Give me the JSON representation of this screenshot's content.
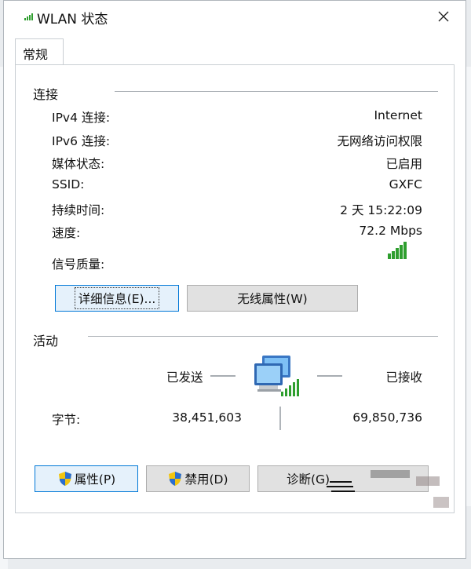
{
  "window": {
    "title": "WLAN 状态"
  },
  "tabs": [
    {
      "label": "常规"
    }
  ],
  "connection": {
    "section_label": "连接",
    "rows": [
      {
        "label": "IPv4 连接:",
        "value": "Internet"
      },
      {
        "label": "IPv6 连接:",
        "value": "无网络访问权限"
      },
      {
        "label": "媒体状态:",
        "value": "已启用"
      },
      {
        "label": "SSID:",
        "value": "GXFC"
      },
      {
        "label": "持续时间:",
        "value": "2 天 15:22:09"
      },
      {
        "label": "速度:",
        "value": "72.2 Mbps"
      }
    ],
    "signal_label": "信号质量:",
    "signal_level": 5,
    "signal_max": 5,
    "details_button": "详细信息(E)...",
    "wireless_props_button": "无线属性(W)"
  },
  "activity": {
    "section_label": "活动",
    "sent_label": "已发送",
    "received_label": "已接收",
    "bytes_label": "字节:",
    "bytes_sent": "38,451,603",
    "bytes_received": "69,850,736"
  },
  "footer": {
    "properties_button": "属性(P)",
    "disable_button": "禁用(D)",
    "diagnose_button": "诊断(G)"
  },
  "colors": {
    "signal_green": "#2e9e2e",
    "focus_blue": "#0078d7"
  },
  "icons": [
    "wifi-icon",
    "close-icon",
    "network-computers-icon",
    "uac-shield-icon"
  ]
}
